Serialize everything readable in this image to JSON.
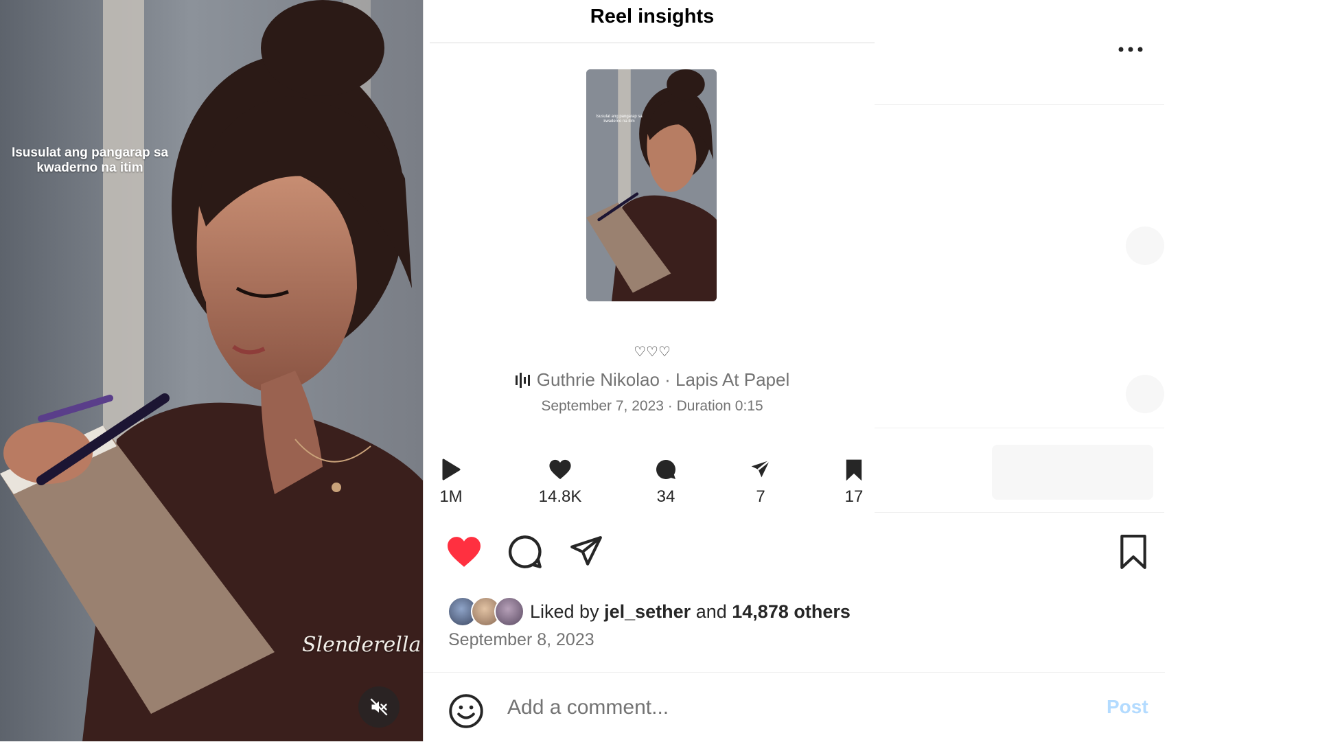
{
  "video": {
    "caption": "Isusulat ang pangarap sa kwaderno na itim",
    "watermark": "Slenderella♥",
    "mute_icon": "speaker-muted-icon"
  },
  "insights": {
    "title": "Reel insights",
    "thumbnail_caption": "Isusulat ang pangarap sa kwaderno na itim",
    "hearts": "♡♡♡",
    "audio_icon": "audio-wave-icon",
    "audio_label": "Guthrie Nikolao · Lapis At Papel",
    "date_duration": "September 7, 2023 · Duration 0:15",
    "stats": [
      {
        "icon": "play-icon",
        "value": "1M"
      },
      {
        "icon": "heart-icon",
        "value": "14.8K"
      },
      {
        "icon": "comment-icon",
        "value": "34"
      },
      {
        "icon": "share-icon",
        "value": "7"
      },
      {
        "icon": "bookmark-icon",
        "value": "17"
      }
    ]
  },
  "post": {
    "more_icon": "more-options-icon",
    "liked": true,
    "like_color": "#ff3040",
    "likes": {
      "prefix": "Liked by",
      "user": "jel_sether",
      "conj": "and",
      "count": "14,878 others"
    },
    "date": "September 8, 2023",
    "comment_placeholder": "Add a comment...",
    "post_label": "Post",
    "post_color": "#b3dbff"
  }
}
